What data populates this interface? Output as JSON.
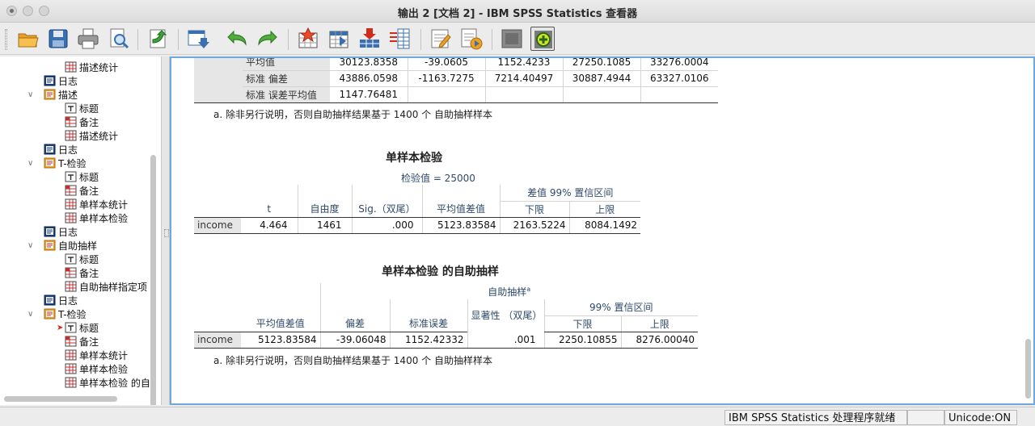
{
  "window": {
    "title": "输出 2 [文档 2] - IBM SPSS Statistics 查看器"
  },
  "toolbar": {
    "buttons": [
      "open-icon",
      "save-icon",
      "print-icon",
      "print-preview-icon",
      "export-icon",
      "recall-dialog-icon",
      "undo-icon",
      "redo-icon",
      "goto-data-icon",
      "goto-case-icon",
      "goto-variable-icon",
      "variables-icon",
      "designate-window-icon",
      "insert-output-icon",
      "collapse-icon",
      "expand-icon"
    ]
  },
  "navigator": {
    "items": [
      {
        "label": "描述统计",
        "icon": "table-icon"
      },
      {
        "label": "日志",
        "icon": "log-icon"
      },
      {
        "label": "描述",
        "icon": "procedure-icon"
      },
      {
        "label": "标题",
        "icon": "title-icon"
      },
      {
        "label": "备注",
        "icon": "notes-icon"
      },
      {
        "label": "描述统计",
        "icon": "table-icon"
      },
      {
        "label": "日志",
        "icon": "log-icon"
      },
      {
        "label": "T-检验",
        "icon": "procedure-icon"
      },
      {
        "label": "标题",
        "icon": "title-icon"
      },
      {
        "label": "备注",
        "icon": "notes-icon"
      },
      {
        "label": "单样本统计",
        "icon": "table-icon"
      },
      {
        "label": "单样本检验",
        "icon": "table-icon"
      },
      {
        "label": "日志",
        "icon": "log-icon"
      },
      {
        "label": "自助抽样",
        "icon": "procedure-icon"
      },
      {
        "label": "标题",
        "icon": "title-icon"
      },
      {
        "label": "备注",
        "icon": "notes-icon"
      },
      {
        "label": "自助抽样指定项",
        "icon": "table-icon"
      },
      {
        "label": "日志",
        "icon": "log-icon"
      },
      {
        "label": "T-检验",
        "icon": "procedure-icon"
      },
      {
        "label": "标题",
        "icon": "title-icon"
      },
      {
        "label": "备注",
        "icon": "notes-icon"
      },
      {
        "label": "单样本统计",
        "icon": "table-icon"
      },
      {
        "label": "单样本检验",
        "icon": "table-icon"
      },
      {
        "label": "单样本检验 的自",
        "icon": "table-icon"
      }
    ]
  },
  "output": {
    "stats_table": {
      "rows": [
        {
          "label": "平均值",
          "values": [
            "30123.8358",
            "-39.0605",
            "1152.4233",
            "27250.1085",
            "33276.0004"
          ]
        },
        {
          "label": "标准 偏差",
          "values": [
            "43886.0598",
            "-1163.7275",
            "7214.40497",
            "30887.4944",
            "63327.0106"
          ]
        },
        {
          "label": "标准 误差平均值",
          "values": [
            "1147.76481",
            "",
            "",
            "",
            ""
          ]
        }
      ],
      "footnote": "a. 除非另行说明，否则自助抽样结果基于 1400 个 自助抽样样本"
    },
    "ttest": {
      "title": "单样本检验",
      "subtitle": "检验值 = 25000",
      "ci_header": "差值 99% 置信区间",
      "columns": [
        "t",
        "自由度",
        "Sig.（双尾）",
        "平均值差值",
        "下限",
        "上限"
      ],
      "row_label": "income",
      "values": [
        "4.464",
        "1461",
        ".000",
        "5123.83584",
        "2163.5224",
        "8084.1492"
      ]
    },
    "bootstrap": {
      "title": "单样本检验 的自助抽样",
      "group_header": "自助抽样",
      "group_sup": "a",
      "ci_header": "99% 置信区间",
      "columns": [
        "平均值差值",
        "偏差",
        "标准误差",
        "显著性 （双尾）",
        "下限",
        "上限"
      ],
      "row_label": "income",
      "values": [
        "5123.83584",
        "-39.06048",
        "1152.42332",
        ".001",
        "2250.10855",
        "8276.00040"
      ],
      "footnote": "a. 除非另行说明，否则自助抽样结果基于 1400 个 自助抽样样本"
    }
  },
  "statusbar": {
    "processor": "IBM SPSS Statistics 处理程序就绪",
    "unicode": "Unicode:ON"
  }
}
